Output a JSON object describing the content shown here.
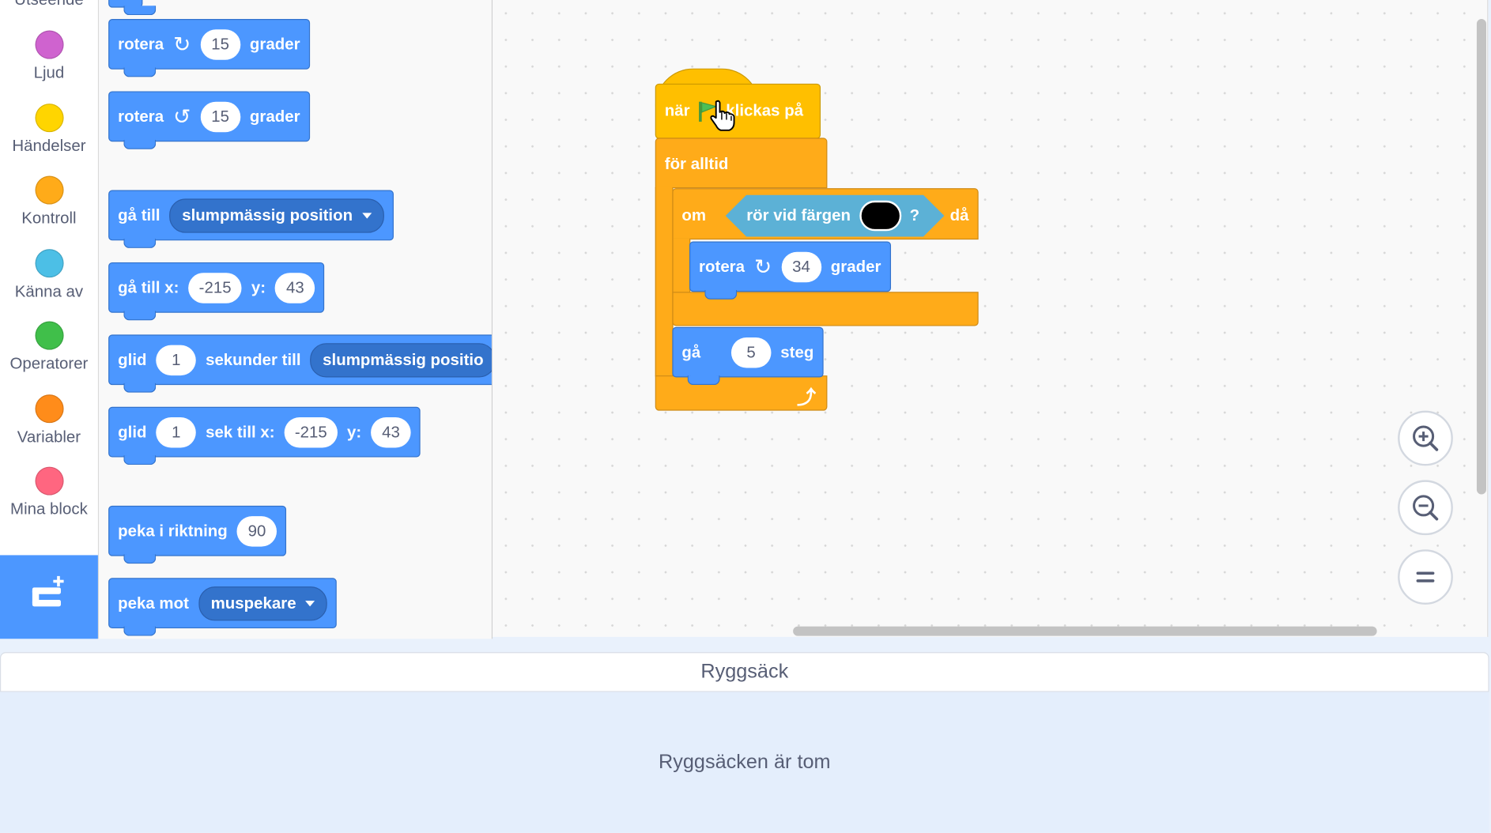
{
  "categories": [
    {
      "label": "Utseende",
      "color": "#9966ff"
    },
    {
      "label": "Ljud",
      "color": "#cf63cf"
    },
    {
      "label": "Händelser",
      "color": "#ffd500"
    },
    {
      "label": "Kontroll",
      "color": "#ffab19"
    },
    {
      "label": "Känna av",
      "color": "#4cbfe6"
    },
    {
      "label": "Operatorer",
      "color": "#40bf4a"
    },
    {
      "label": "Variabler",
      "color": "#ff8c1a"
    },
    {
      "label": "Mina block",
      "color": "#ff6680"
    }
  ],
  "palette": {
    "turn_right": {
      "text": "rotera",
      "value": "15",
      "unit": "grader"
    },
    "turn_left": {
      "text": "rotera",
      "value": "15",
      "unit": "grader"
    },
    "goto": {
      "text": "gå till",
      "option": "slumpmässig position"
    },
    "goto_xy": {
      "text": "gå till x:",
      "x": "-215",
      "y_label": "y:",
      "y": "43"
    },
    "glide_to": {
      "text": "glid",
      "secs": "1",
      "mid": "sekunder till",
      "option": "slumpmässig positio"
    },
    "glide_xy": {
      "text": "glid",
      "secs": "1",
      "mid": "sek till x:",
      "x": "-215",
      "y_label": "y:",
      "y": "43"
    },
    "point_dir": {
      "text": "peka i riktning",
      "value": "90"
    },
    "point_towards": {
      "text": "peka mot",
      "option": "muspekare"
    }
  },
  "script": {
    "hat_pre": "när",
    "hat_post": "klickas på",
    "forever": "för alltid",
    "if_label": "om",
    "sense_text": "rör vid färgen",
    "sense_q": "?",
    "then_label": "då",
    "turn": {
      "text": "rotera",
      "value": "34",
      "unit": "grader"
    },
    "move": {
      "text": "gå",
      "value": "5",
      "unit": "steg"
    }
  },
  "backpack": {
    "title": "Ryggsäck",
    "empty_text": "Ryggsäcken är tom"
  },
  "colors": {
    "motion": "#4c97ff",
    "events": "#ffbf00",
    "control": "#ffab19",
    "sensing": "#5cb1d6"
  }
}
